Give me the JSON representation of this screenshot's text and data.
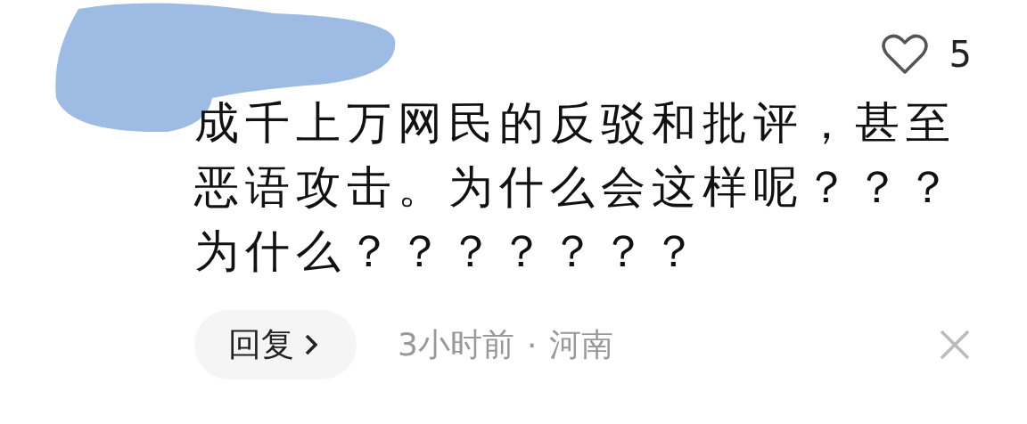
{
  "comment": {
    "likes": "5",
    "text": "成千上万网民的反驳和批评，甚至恶语攻击。为什么会这样呢？？？为什么？？？？？？？",
    "reply_button": "回复",
    "time": "3小时前",
    "separator": "·",
    "location": "河南"
  }
}
